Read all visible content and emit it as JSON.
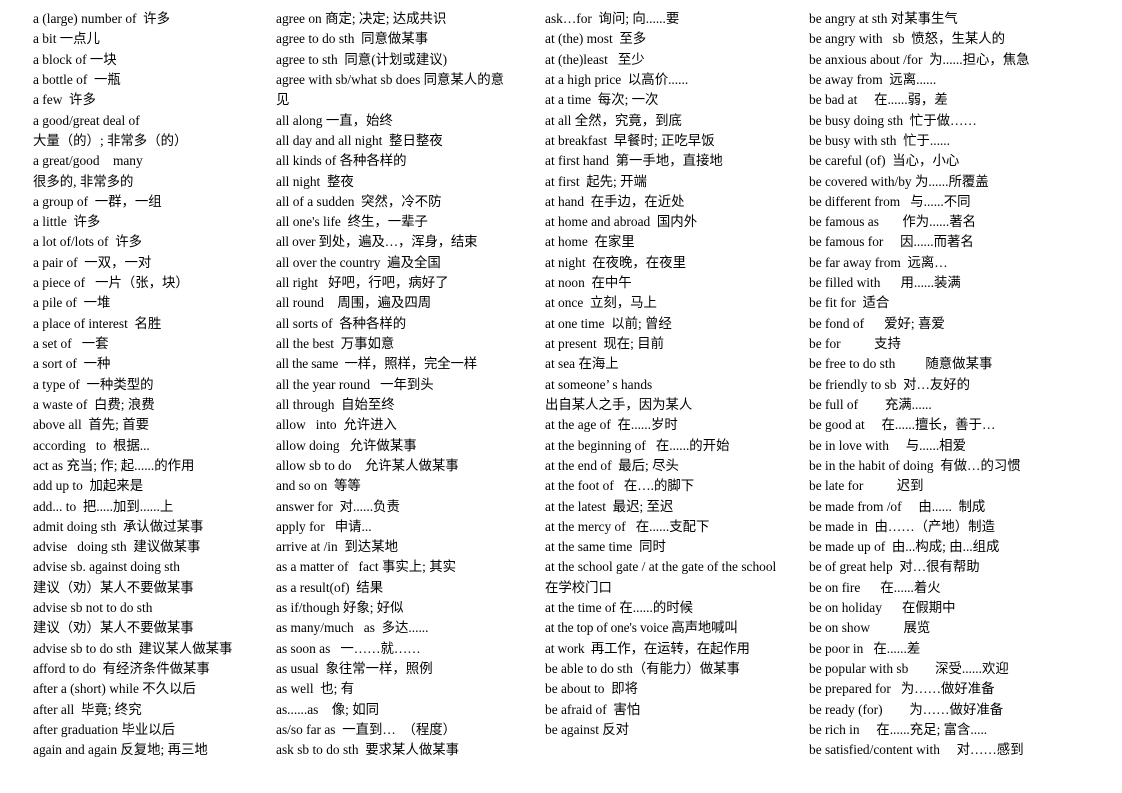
{
  "document": {
    "title": "English Phrases Reference Sheet",
    "kind": "four-column glossary",
    "text_color": "#000000",
    "background_color": "#ffffff"
  },
  "columns": [
    {
      "name": "column-1",
      "entries": [
        "a (large) number of  许多",
        "a bit 一点儿",
        "a block of 一块",
        "a bottle of  一瓶",
        "a few  许多",
        "a good/great deal of",
        "大量（的）; 非常多（的）",
        "a great/good    many",
        "很多的, 非常多的",
        "a group of  一群，一组",
        "a little  许多",
        "a lot of/lots of  许多",
        "a pair of  一双，一对",
        "a piece of   一片（张，块）",
        "a pile of  一堆",
        "a place of interest  名胜",
        "a set of   一套",
        "a sort of  一种",
        "a type of  一种类型的",
        "a waste of  白费; 浪费",
        "above all  首先; 首要",
        "according   to  根据...",
        "act as 充当; 作; 起......的作用",
        "add up to  加起来是",
        "add... to  把.....加到......上",
        "admit doing sth  承认做过某事",
        "advise   doing sth  建议做某事",
        "advise sb. against doing sth",
        "建议（劝）某人不要做某事",
        "advise sb not to do sth",
        "建议（劝）某人不要做某事",
        "advise sb to do sth  建议某人做某事",
        "afford to do  有经济条件做某事",
        "after a (short) while 不久以后",
        "after all  毕竟; 终究",
        "after graduation 毕业以后",
        "again and again 反复地; 再三地"
      ]
    },
    {
      "name": "column-2",
      "entries": [
        "agree on 商定; 决定; 达成共识",
        "agree to do sth  同意做某事",
        "agree to sth  同意(计划或建议)",
        "agree with sb/what sb does 同意某人的意",
        "见",
        "all along 一直，始终",
        "all day and all night  整日整夜",
        "all kinds of 各种各样的",
        "all night  整夜",
        "all of a sudden  突然，冷不防",
        "all one's life  终生，一辈子",
        "all over 到处，遍及…，浑身，结束",
        "all over the country  遍及全国",
        "all right   好吧，行吧，病好了",
        "all round    周围，遍及四周",
        "all sorts of  各种各样的",
        "all the best  万事如意",
        "all the same  一样，照样，完全一样",
        "all the year round   一年到头",
        "all through  自始至终",
        "allow   into  允许进入",
        "allow doing   允许做某事",
        "allow sb to do    允许某人做某事",
        "and so on  等等",
        "answer for  对......负责",
        "apply for   申请...",
        "arrive at /in  到达某地",
        "as a matter of   fact 事实上; 其实",
        "as a result(of)  结果",
        "as if/though 好象; 好似",
        "as many/much   as  多达......",
        "as soon as   一……就……",
        "as usual  象往常一样，照例",
        "as well  也; 有",
        "as......as    像; 如同",
        "as/so far as  一直到…  （程度）",
        "ask sb to do sth  要求某人做某事"
      ]
    },
    {
      "name": "column-3",
      "entries": [
        "ask…for  询问; 向......要",
        "at (the) most  至多",
        "at (the)least   至少",
        "at a high price  以高价......",
        "at a time  每次; 一次",
        "at all 全然，究竟，到底",
        "at breakfast  早餐时; 正吃早饭",
        "at first hand  第一手地，直接地",
        "at first  起先; 开端",
        "at hand  在手边，在近处",
        "at home and abroad  国内外",
        "at home  在家里",
        "at night  在夜晚，在夜里",
        "at noon  在中午",
        "at once  立刻，马上",
        "at one time  以前; 曾经",
        "at present  现在; 目前",
        "at sea 在海上",
        "at someone’ s hands",
        "出自某人之手，因为某人",
        "at the age of  在......岁时",
        "at the beginning of   在......的开始",
        "at the end of  最后; 尽头",
        "at the foot of   在….的脚下",
        "at the latest  最迟; 至迟",
        "at the mercy of   在......支配下",
        "at the same time  同时",
        "at the school gate / at the gate of the school",
        "在学校门口",
        "at the time of 在......的时候",
        "at the top of one's voice 高声地喊叫",
        "at work  再工作，在运转，在起作用",
        "be able to do sth（有能力）做某事",
        "be about to  即将",
        "be afraid of  害怕",
        "be against 反对"
      ]
    },
    {
      "name": "column-4",
      "entries": [
        "be angry at sth 对某事生气",
        "be angry with   sb  愤怒，生某人的",
        "be anxious about /for  为......担心，焦急",
        "be away from  远离......",
        "be bad at     在......弱，差",
        "be busy doing sth  忙于做……",
        "be busy with sth  忙于......",
        "be careful (of)  当心，小心",
        "be covered with/by 为......所覆盖",
        "be different from   与......不同",
        "be famous as       作为......著名",
        "be famous for     因......而著名",
        "be far away from  远离…",
        "be filled with      用......装满",
        "be fit for  适合",
        "be fond of      爱好; 喜爱",
        "be for          支持",
        "be free to do sth         随意做某事",
        "be friendly to sb  对…友好的",
        "be full of        充满......",
        "be good at     在......擅长，善于…",
        "be in love with     与......相爱",
        "be in the habit of doing  有做…的习惯",
        "be late for          迟到",
        "be made from /of     由......  制成",
        "be made in  由……（产地）制造",
        "be made up of  由...构成; 由...组成",
        "be of great help  对…很有帮助",
        "be on fire      在......着火",
        "be on holiday      在假期中",
        "be on show          展览",
        "be poor in   在......差",
        "be popular with sb        深受......欢迎",
        "be prepared for   为……做好准备",
        "be ready (for)        为……做好准备",
        "be rich in     在......充足; 富含.....",
        "be satisfied/content with     对……感到"
      ]
    }
  ]
}
